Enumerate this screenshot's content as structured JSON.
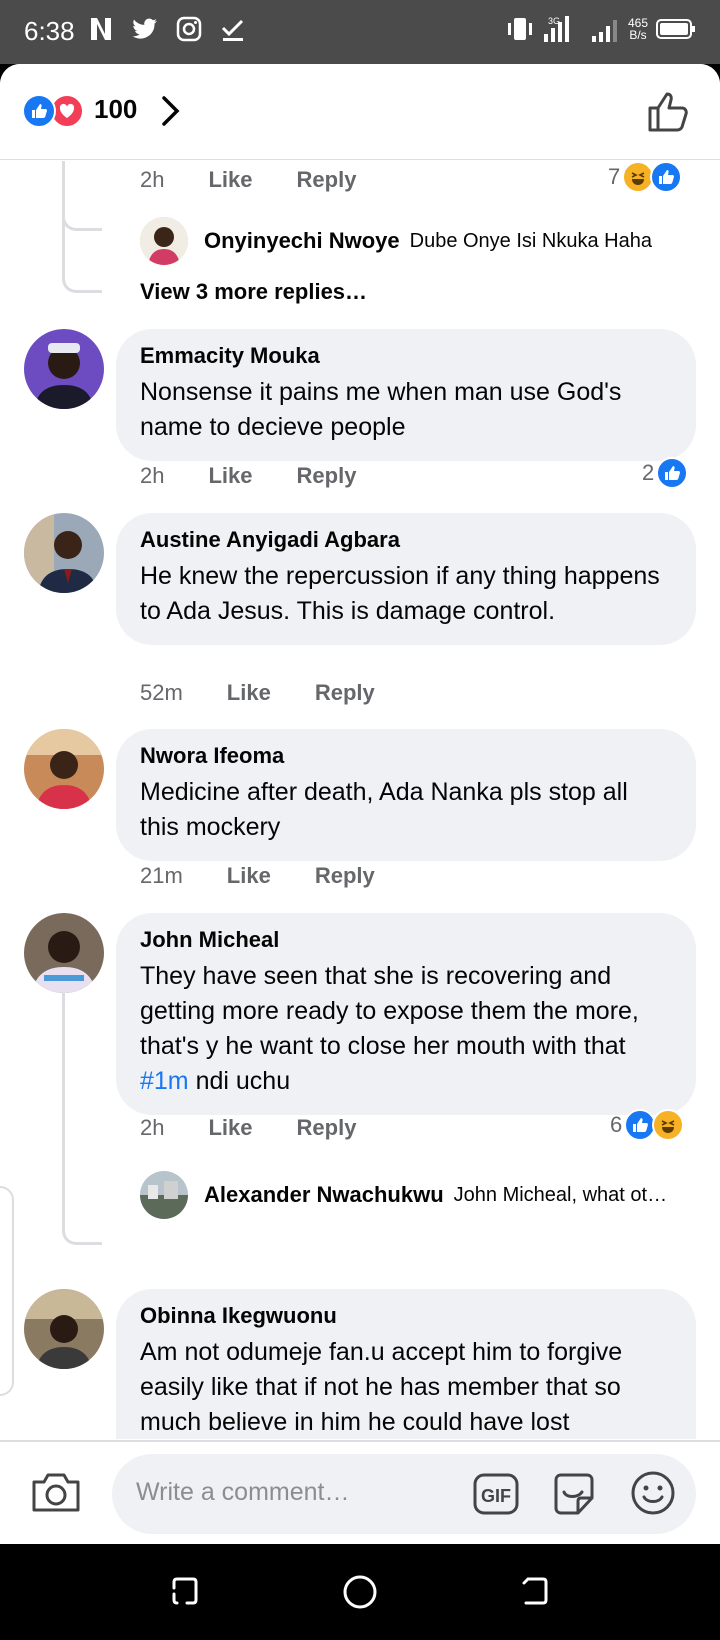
{
  "status_bar": {
    "time": "6:38",
    "speed_value": "465",
    "speed_unit": "B/s",
    "network": "3G"
  },
  "header": {
    "reaction_count": "100",
    "reaction_icons": [
      "like-icon",
      "love-icon"
    ]
  },
  "comments": [
    {
      "time": "2h",
      "like_label": "Like",
      "reply_label": "Reply",
      "reaction_count": "7",
      "reaction_icons": [
        "haha-icon",
        "like-icon"
      ],
      "replies": [
        {
          "name": "Onyinyechi Nwoye",
          "text": "Dube Onye Isi Nkuka Haha"
        }
      ],
      "view_more": "View 3 more replies…"
    },
    {
      "name": "Emmacity Mouka",
      "text": "Nonsense it pains me when man use God's name to decieve people",
      "time": "2h",
      "like_label": "Like",
      "reply_label": "Reply",
      "reaction_count": "2",
      "reaction_icons": [
        "like-icon"
      ]
    },
    {
      "name": "Austine Anyigadi Agbara",
      "text": "He knew the repercussion if any thing happens to Ada Jesus. This is damage control.",
      "time": "52m",
      "like_label": "Like",
      "reply_label": "Reply"
    },
    {
      "name": "Nwora Ifeoma",
      "text": "Medicine after death, Ada Nanka pls stop all this mockery",
      "time": "21m",
      "like_label": "Like",
      "reply_label": "Reply"
    },
    {
      "name": "John Micheal",
      "text_before": "They have seen that she is recovering and getting more ready to expose them the more, that's y he want to close her mouth with that ",
      "hashtag": "#1m",
      "text_after": " ndi uchu",
      "time": "2h",
      "like_label": "Like",
      "reply_label": "Reply",
      "reaction_count": "6",
      "reaction_icons": [
        "like-icon",
        "haha-icon"
      ],
      "replies": [
        {
          "name": "Alexander Nwachukwu",
          "text": "John Micheal, what ot…"
        }
      ]
    },
    {
      "name": "Obinna Ikegwuonu",
      "text": "Am not odumeje fan.u accept him to forgive easily like that if not he has member that so much believe in him he could have lost"
    }
  ],
  "composer": {
    "placeholder": "Write a comment…",
    "gif_label": "GIF"
  },
  "colors": {
    "accent": "#1877f2",
    "love": "#f33e58",
    "haha": "#f7b125",
    "bubble": "#eff1f4",
    "meta_text": "#65676b"
  }
}
